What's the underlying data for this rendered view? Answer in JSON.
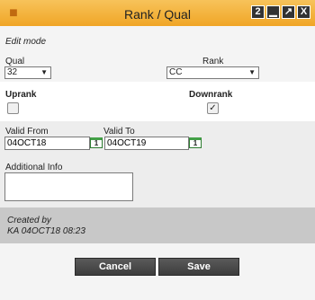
{
  "window": {
    "title": "Rank / Qual",
    "buttons": [
      "2",
      "▁",
      "↗",
      "X"
    ]
  },
  "mode_label": "Edit mode",
  "qual": {
    "label": "Qual",
    "value": "32"
  },
  "rank": {
    "label": "Rank",
    "value": "CC"
  },
  "uprank": {
    "label": "Uprank",
    "checked": false
  },
  "downrank": {
    "label": "Downrank",
    "checked": true
  },
  "valid_from": {
    "label": "Valid From",
    "value": "04OCT18"
  },
  "valid_to": {
    "label": "Valid To",
    "value": "04OCT19"
  },
  "calendar_icon_text": "1",
  "additional_info": {
    "label": "Additional Info",
    "value": ""
  },
  "created": {
    "label": "Created by",
    "value": "KA 04OCT18 08:23"
  },
  "actions": {
    "cancel": "Cancel",
    "save": "Save"
  }
}
